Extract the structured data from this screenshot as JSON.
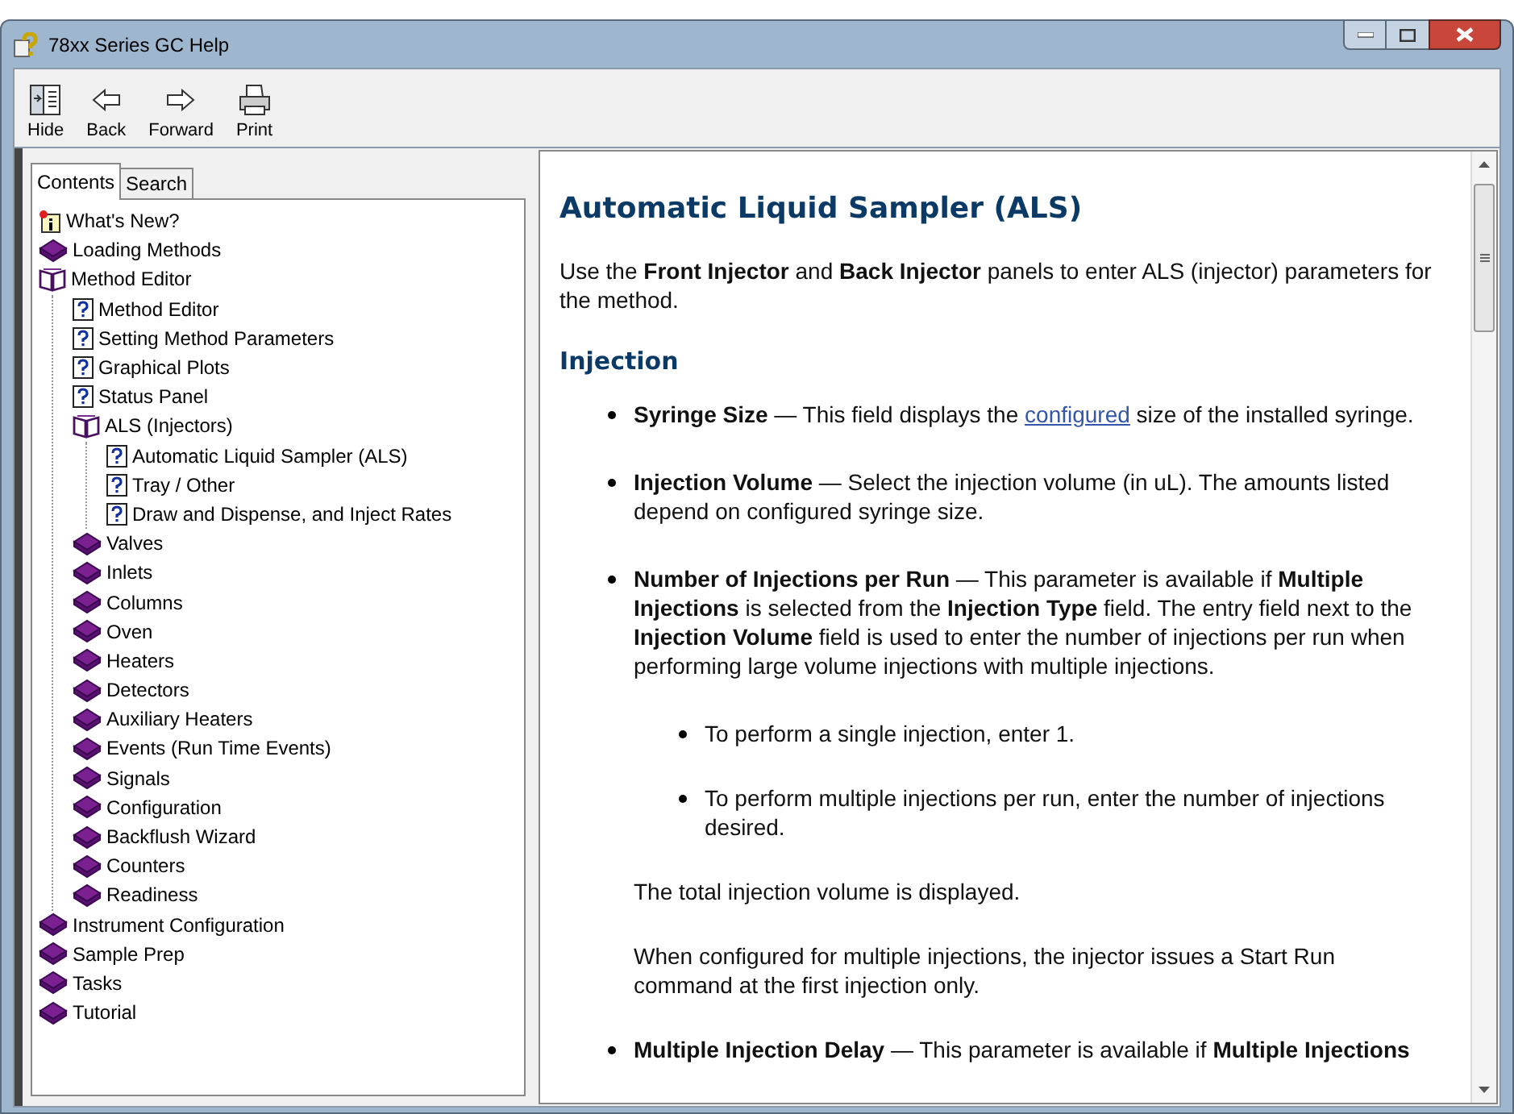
{
  "window": {
    "title": "78xx Series GC Help"
  },
  "toolbar": [
    {
      "kind": "hide",
      "label": "Hide"
    },
    {
      "kind": "back",
      "label": "Back"
    },
    {
      "kind": "forward",
      "label": "Forward"
    },
    {
      "kind": "print",
      "label": "Print"
    }
  ],
  "tabs": [
    {
      "label": "Contents",
      "selected": true
    },
    {
      "label": "Search",
      "selected": false
    }
  ],
  "tree": [
    {
      "kind": "new",
      "label": "What's New?"
    },
    {
      "kind": "book",
      "label": "Loading Methods",
      "expanded": false
    },
    {
      "kind": "book",
      "label": "Method Editor",
      "expanded": true,
      "children": [
        {
          "kind": "page",
          "label": "Method Editor"
        },
        {
          "kind": "page",
          "label": "Setting Method Parameters"
        },
        {
          "kind": "page",
          "label": "Graphical Plots"
        },
        {
          "kind": "page",
          "label": "Status Panel"
        },
        {
          "kind": "book",
          "label": "ALS (Injectors)",
          "expanded": true,
          "children": [
            {
              "kind": "page",
              "label": "Automatic Liquid Sampler (ALS)"
            },
            {
              "kind": "page",
              "label": "Tray / Other"
            },
            {
              "kind": "page",
              "label": "Draw and Dispense, and Inject Rates"
            }
          ]
        },
        {
          "kind": "book",
          "label": "Valves",
          "expanded": false
        },
        {
          "kind": "book",
          "label": "Inlets",
          "expanded": false
        },
        {
          "kind": "book",
          "label": "Columns",
          "expanded": false
        },
        {
          "kind": "book",
          "label": "Oven",
          "expanded": false
        },
        {
          "kind": "book",
          "label": "Heaters",
          "expanded": false
        },
        {
          "kind": "book",
          "label": "Detectors",
          "expanded": false
        },
        {
          "kind": "book",
          "label": "Auxiliary Heaters",
          "expanded": false
        },
        {
          "kind": "book",
          "label": "Events (Run Time Events)",
          "expanded": false
        },
        {
          "kind": "book",
          "label": "Signals",
          "expanded": false
        },
        {
          "kind": "book",
          "label": "Configuration",
          "expanded": false
        },
        {
          "kind": "book",
          "label": "Backflush Wizard",
          "expanded": false
        },
        {
          "kind": "book",
          "label": "Counters",
          "expanded": false
        },
        {
          "kind": "book",
          "label": "Readiness",
          "expanded": false
        }
      ]
    },
    {
      "kind": "book",
      "label": "Instrument Configuration",
      "expanded": false
    },
    {
      "kind": "book",
      "label": "Sample Prep",
      "expanded": false
    },
    {
      "kind": "book",
      "label": "Tasks",
      "expanded": false
    },
    {
      "kind": "book",
      "label": "Tutorial",
      "expanded": false
    }
  ],
  "content": [
    {
      "kind": "h1",
      "segments": [
        {
          "kind": "text",
          "text": "Automatic Liquid Sampler (ALS)"
        }
      ]
    },
    {
      "kind": "p",
      "segments": [
        {
          "kind": "text",
          "text": "Use the **Front Injector** and **Back Injector** panels to enter ALS (injector) parameters for the method."
        }
      ]
    },
    {
      "kind": "h2",
      "segments": [
        {
          "kind": "text",
          "text": "Injection"
        }
      ]
    },
    {
      "kind": "bullet",
      "segments": [
        {
          "kind": "text",
          "text": "**Syringe Size** — This field displays the "
        },
        {
          "kind": "link",
          "text": "configured"
        },
        {
          "kind": "text",
          "text": " size of the installed syringe."
        }
      ]
    },
    {
      "kind": "bullet",
      "segments": [
        {
          "kind": "text",
          "text": "**Injection Volume** — Select the injection volume (in uL). The amounts listed depend on configured syringe size."
        }
      ]
    },
    {
      "kind": "bullet",
      "segments": [
        {
          "kind": "text",
          "text": "**Number of Injections per Run** — This parameter is available if **Multiple Injections** is selected from the **Injection Type** field. The entry field next to the **Injection Volume** field is used to enter the number of injections per run when performing large volume injections with multiple injections."
        }
      ]
    },
    {
      "kind": "subbullet",
      "segments": [
        {
          "kind": "text",
          "text": "To perform a single injection, enter 1."
        }
      ]
    },
    {
      "kind": "subbullet",
      "segments": [
        {
          "kind": "text",
          "text": "To perform multiple injections per run, enter the number of injections desired."
        }
      ]
    },
    {
      "kind": "note",
      "segments": [
        {
          "kind": "text",
          "text": "The total injection volume is displayed."
        }
      ]
    },
    {
      "kind": "note",
      "segments": [
        {
          "kind": "text",
          "text": "When configured for multiple injections, the injector issues a Start Run command at the first injection only."
        }
      ]
    },
    {
      "kind": "bullet",
      "segments": [
        {
          "kind": "text",
          "text": "**Multiple Injection Delay** — This parameter is available if **Multiple Injections**"
        }
      ]
    }
  ]
}
